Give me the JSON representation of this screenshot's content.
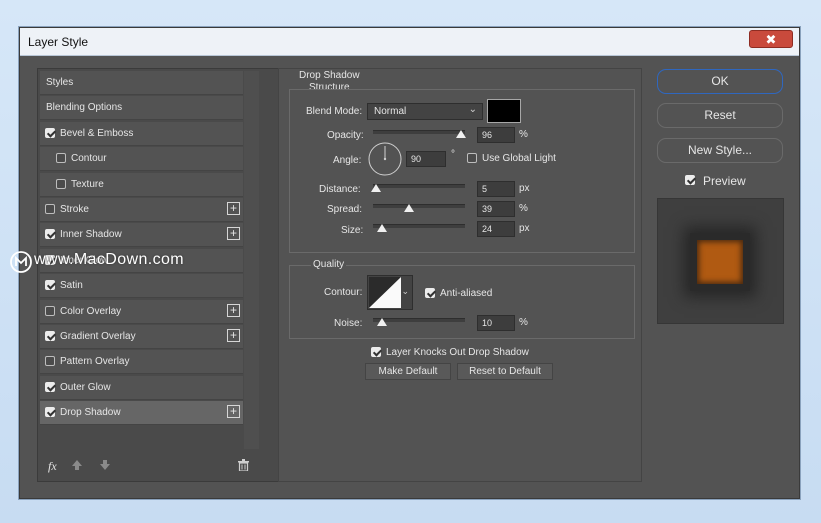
{
  "window": {
    "title": "Layer Style",
    "close_glyph": "✖"
  },
  "watermark": {
    "text": "www.MacDown.com"
  },
  "left_panel": {
    "items": [
      {
        "label": "Styles",
        "checkbox": "none",
        "plus": false
      },
      {
        "label": "Blending Options",
        "checkbox": "none",
        "plus": false
      },
      {
        "label": "Bevel & Emboss",
        "checkbox": "checked",
        "plus": false
      },
      {
        "label": "Contour",
        "checkbox": "unchecked",
        "plus": false
      },
      {
        "label": "Texture",
        "checkbox": "unchecked",
        "plus": false
      },
      {
        "label": "Stroke",
        "checkbox": "unchecked",
        "plus": true
      },
      {
        "label": "Inner Shadow",
        "checkbox": "checked",
        "plus": true
      },
      {
        "label": "Inner Glow",
        "checkbox": "checked",
        "plus": false
      },
      {
        "label": "Satin",
        "checkbox": "checked",
        "plus": false
      },
      {
        "label": "Color Overlay",
        "checkbox": "unchecked",
        "plus": true
      },
      {
        "label": "Gradient Overlay",
        "checkbox": "checked",
        "plus": true
      },
      {
        "label": "Pattern Overlay",
        "checkbox": "unchecked",
        "plus": false
      },
      {
        "label": "Outer Glow",
        "checkbox": "checked",
        "plus": false
      },
      {
        "label": "Drop Shadow",
        "checkbox": "checked",
        "plus": true,
        "selected": true
      }
    ],
    "footer": {
      "fx_label": "fx"
    }
  },
  "drop_shadow": {
    "heading": "Drop Shadow",
    "structure_heading": "Structure",
    "blend_mode": {
      "label": "Blend Mode:",
      "value": "Normal",
      "color": "#000000"
    },
    "opacity": {
      "label": "Opacity:",
      "value": "96",
      "unit": "%",
      "level": 0.96
    },
    "angle": {
      "label": "Angle:",
      "value": "90",
      "unit": "°",
      "use_global_light": "Use Global Light"
    },
    "distance": {
      "label": "Distance:",
      "value": "5",
      "unit": "px",
      "level": 0.03
    },
    "spread": {
      "label": "Spread:",
      "value": "39",
      "unit": "%",
      "level": 0.39
    },
    "size": {
      "label": "Size:",
      "value": "24",
      "unit": "px",
      "level": 0.1
    },
    "quality_heading": "Quality",
    "contour": {
      "label": "Contour:",
      "anti_aliased": "Anti-aliased"
    },
    "noise": {
      "label": "Noise:",
      "value": "10",
      "unit": "%",
      "level": 0.1
    },
    "knocks_out": "Layer Knocks Out Drop Shadow",
    "make_default": "Make Default",
    "reset_to_default": "Reset to Default"
  },
  "right_panel": {
    "ok": "OK",
    "reset": "Reset",
    "new_style": "New Style...",
    "preview": "Preview"
  },
  "colors": {
    "accent_blue": "#2f67bf",
    "preview_fill": "#b05a12",
    "close_red": "#c94a3c"
  }
}
